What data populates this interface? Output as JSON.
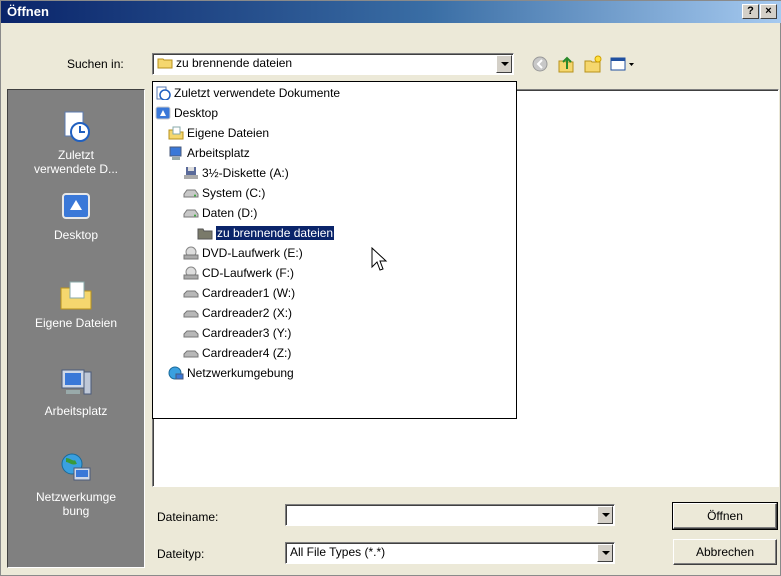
{
  "window": {
    "title": "Öffnen",
    "help_btn": "?",
    "close_btn": "×"
  },
  "look_in": {
    "label": "Suchen in:",
    "value": "zu brennende dateien"
  },
  "dropdown_items": [
    {
      "label": "Zuletzt verwendete Dokumente",
      "icon": "recent-docs-icon"
    },
    {
      "label": "Desktop",
      "icon": "desktop-icon"
    },
    {
      "label": "Eigene Dateien",
      "icon": "my-documents-icon"
    },
    {
      "label": "Arbeitsplatz",
      "icon": "my-computer-icon"
    },
    {
      "label": "3½-Diskette (A:)",
      "icon": "floppy-icon"
    },
    {
      "label": "System (C:)",
      "icon": "hard-drive-icon"
    },
    {
      "label": "Daten (D:)",
      "icon": "hard-drive-icon"
    },
    {
      "label": "zu brennende dateien",
      "icon": "folder-icon",
      "selected": true
    },
    {
      "label": "DVD-Laufwerk (E:)",
      "icon": "cd-drive-icon"
    },
    {
      "label": "CD-Laufwerk (F:)",
      "icon": "cd-drive-icon"
    },
    {
      "label": "Cardreader1 (W:)",
      "icon": "removable-drive-icon"
    },
    {
      "label": "Cardreader2 (X:)",
      "icon": "removable-drive-icon"
    },
    {
      "label": "Cardreader3 (Y:)",
      "icon": "removable-drive-icon"
    },
    {
      "label": "Cardreader4 (Z:)",
      "icon": "removable-drive-icon"
    },
    {
      "label": "Netzwerkumgebung",
      "icon": "network-icon"
    }
  ],
  "places": [
    {
      "label": "Zuletzt verwendete D...",
      "label_l1": "Zuletzt",
      "label_l2": "verwendete D...",
      "icon": "recent-docs-icon"
    },
    {
      "label": "Desktop",
      "icon": "desktop-icon"
    },
    {
      "label": "Eigene Dateien",
      "icon": "my-documents-icon"
    },
    {
      "label": "Arbeitsplatz",
      "icon": "my-computer-icon"
    },
    {
      "label": "Netzwerkumgebung",
      "label_l1": "Netzwerkumge",
      "label_l2": "bung",
      "icon": "network-icon"
    }
  ],
  "filename": {
    "label": "Dateiname:",
    "value": ""
  },
  "filetype": {
    "label": "Dateityp:",
    "value": "All File Types (*.*)"
  },
  "buttons": {
    "open": "Öffnen",
    "cancel": "Abbrechen"
  },
  "colors": {
    "selection": "#0a246a",
    "sidebar": "#808080",
    "dialog": "#ece9d8"
  }
}
